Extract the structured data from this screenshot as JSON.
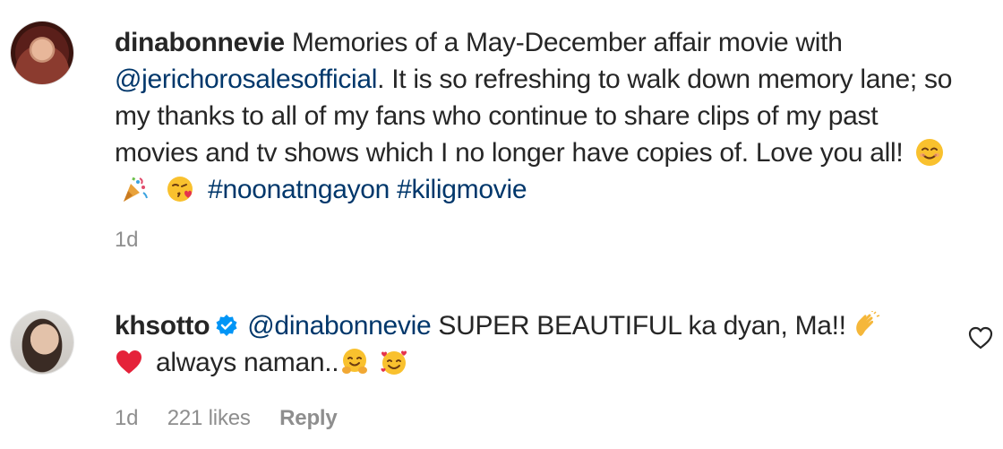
{
  "caption": {
    "username": "dinabonnevie",
    "text_1": "Memories of a May-December affair movie with",
    "mention": "@jerichorosalesofficial",
    "text_2": ". It is so refreshing to walk down memory lane; so my thanks to all of my fans who continue to share clips of my past movies and tv shows which I no longer have copies of. Love you all!",
    "hashtag_1": "#noonatngayon",
    "hashtag_2": "#kiligmovie",
    "emojis": [
      "smiling-face-icon",
      "party-popper-icon",
      "face-blowing-kiss-icon"
    ],
    "time": "1d"
  },
  "comment": {
    "username": "khsotto",
    "verified": true,
    "mention": "@dinabonnevie",
    "text_1": "SUPER BEAUTIFUL ka dyan, Ma!!",
    "text_2": "always naman..",
    "emojis": [
      "clapping-hands-icon",
      "red-heart-icon",
      "hugging-face-icon",
      "smiling-face-with-hearts-icon"
    ],
    "time": "1d",
    "likes": "221 likes",
    "reply_label": "Reply"
  },
  "colors": {
    "link": "#00376b",
    "meta": "#8e8e8e",
    "verified": "#0095f6",
    "heart": "#ed4956"
  }
}
